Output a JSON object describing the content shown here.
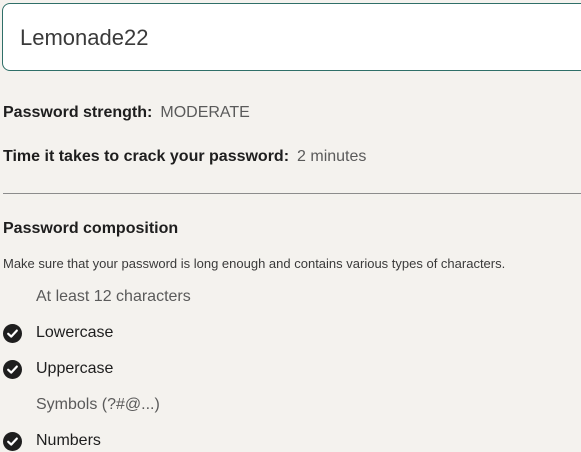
{
  "password_field": {
    "value": "Lemonade22"
  },
  "strength": {
    "label": "Password strength:",
    "value": "MODERATE"
  },
  "crack_time": {
    "label": "Time it takes to crack your password:",
    "value": "2 minutes"
  },
  "composition": {
    "title": "Password composition",
    "description": "Make sure that your password is long enough and contains various types of characters.",
    "requirements": [
      {
        "label": "At least 12 characters",
        "met": false,
        "icon": "check-circle-icon"
      },
      {
        "label": "Lowercase",
        "met": true,
        "icon": "check-circle-icon"
      },
      {
        "label": "Uppercase",
        "met": true,
        "icon": "check-circle-icon"
      },
      {
        "label": "Symbols (?#@...)",
        "met": false,
        "icon": "check-circle-icon"
      },
      {
        "label": "Numbers",
        "met": true,
        "icon": "check-circle-icon"
      }
    ]
  }
}
